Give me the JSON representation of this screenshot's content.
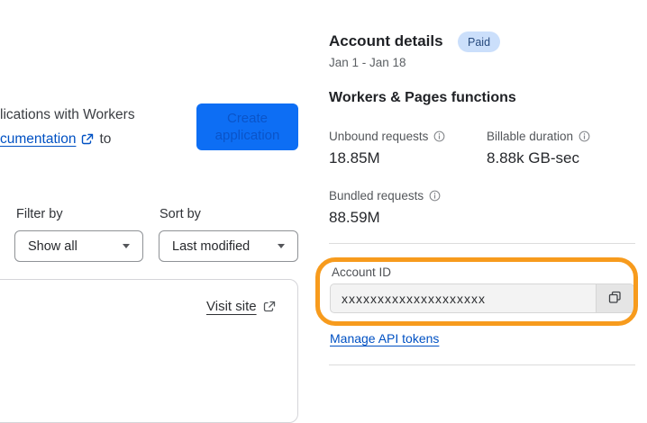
{
  "left_panel": {
    "intro_line1": "lications with Workers",
    "intro_link_text": "cumentation",
    "intro_tail_text": "to",
    "create_button_label": "Create application",
    "filter": {
      "label": "Filter by",
      "value": "Show all"
    },
    "sort": {
      "label": "Sort by",
      "value": "Last modified"
    },
    "visit_site_label": "Visit site"
  },
  "account_panel": {
    "title": "Account details",
    "plan_badge": "Paid",
    "date_range": "Jan 1 - Jan 18",
    "section_heading": "Workers & Pages functions",
    "metrics": [
      {
        "label": "Unbound requests",
        "value": "18.85M"
      },
      {
        "label": "Billable duration",
        "value": "8.88k GB-sec"
      },
      {
        "label": "Bundled requests",
        "value": "88.59M"
      }
    ],
    "account_id": {
      "label": "Account ID",
      "value": "xxxxxxxxxxxxxxxxxxxx"
    },
    "manage_tokens_label": "Manage API tokens"
  },
  "icons": {
    "external_link": "external-link-icon",
    "info": "info-icon",
    "copy": "copy-icon",
    "dropdown_caret": "chevron-down-icon"
  },
  "colors": {
    "primary_button_bg": "#0d6ef4",
    "primary_button_text": "#0a54c9",
    "link_blue": "#0051c3",
    "badge_bg": "#cbdffb",
    "badge_text": "#274a7e",
    "annotation_orange": "#f79b1d",
    "divider": "#dcdcdc",
    "input_bg": "#f3f3f3"
  }
}
